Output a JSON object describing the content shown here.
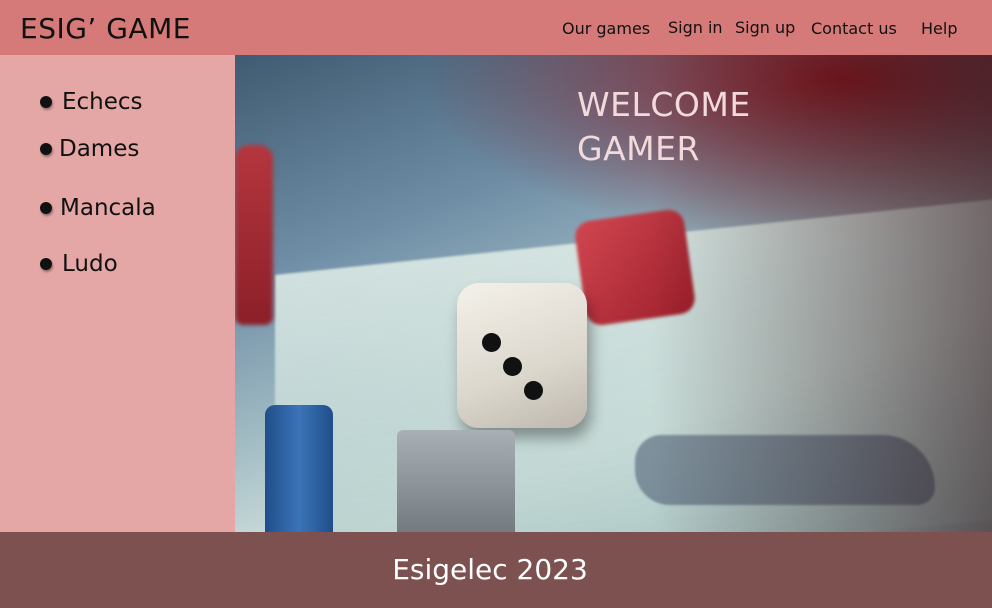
{
  "header": {
    "logo": "ESIG’ GAME",
    "nav": {
      "our_games": "Our games",
      "sign_in": "Sign in",
      "sign_up": "Sign up",
      "contact_us": "Contact us",
      "help": "Help"
    }
  },
  "sidebar": {
    "items": [
      {
        "label": "Echecs"
      },
      {
        "label": "Dames"
      },
      {
        "label": "Mancala"
      },
      {
        "label": "Ludo"
      }
    ]
  },
  "hero": {
    "welcome_line1": "WELCOME",
    "welcome_line2": "GAMER"
  },
  "footer": {
    "text": "Esigelec 2023"
  },
  "colors": {
    "header_bg": "#d57a78",
    "sidebar_bg": "#e4a7a6",
    "footer_bg": "#7d5150"
  }
}
